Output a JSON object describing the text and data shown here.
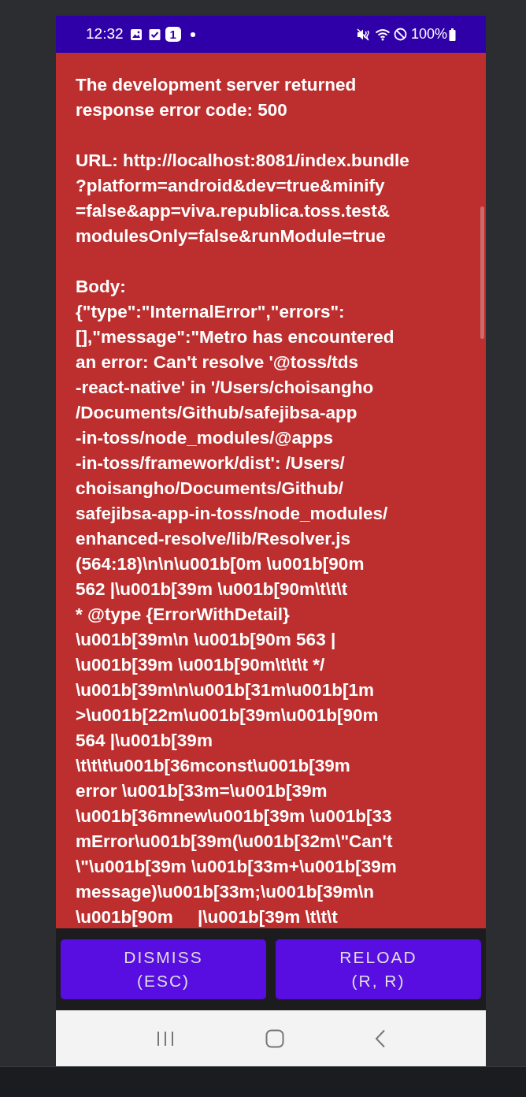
{
  "status_bar": {
    "time": "12:32",
    "notification_count": "1",
    "battery": "100%"
  },
  "error": {
    "heading": {
      "lines": [
        "The development server returned",
        "response error code: 500"
      ]
    },
    "url": {
      "lines": [
        "URL: http://localhost:8081/index.bundle",
        "?platform=android&dev=true&minify",
        "=false&app=viva.republica.toss.test&",
        "modulesOnly=false&runModule=true"
      ]
    },
    "body": {
      "lines": [
        "Body:",
        "{\"type\":\"InternalError\",\"errors\":",
        "[],\"message\":\"Metro has encountered",
        "an error: Can't resolve '@toss/tds",
        "-react-native' in '/Users/choisangho",
        "/Documents/Github/safejibsa-app",
        "-in-toss/node_modules/@apps",
        "-in-toss/framework/dist': /Users/",
        "choisangho/Documents/Github/",
        "safejibsa-app-in-toss/node_modules/",
        "enhanced-resolve/lib/Resolver.js",
        "(564:18)\\n\\n\\u001b[0m \\u001b[90m",
        "562 |\\u001b[39m \\u001b[90m\\t\\t\\t",
        "* @type {ErrorWithDetail}",
        "\\u001b[39m\\n \\u001b[90m 563 |",
        "\\u001b[39m \\u001b[90m\\t\\t\\t */",
        "\\u001b[39m\\n\\u001b[31m\\u001b[1m",
        ">\\u001b[22m\\u001b[39m\\u001b[90m",
        "564 |\\u001b[39m",
        "\\t\\t\\t\\u001b[36mconst\\u001b[39m",
        "error \\u001b[33m=\\u001b[39m",
        "\\u001b[36mnew\\u001b[39m \\u001b[33",
        "mError\\u001b[39m(\\u001b[32m\\\"Can't",
        "\\\"\\u001b[39m \\u001b[33m+\\u001b[39m",
        "message)\\u001b[33m;\\u001b[39m\\n",
        "\\u001b[90m     |\\u001b[39m \\t\\t\\t"
      ]
    }
  },
  "buttons": [
    {
      "lines": [
        "DISMISS",
        "(ESC)"
      ]
    },
    {
      "lines": [
        "RELOAD",
        "(R, R)"
      ]
    }
  ]
}
